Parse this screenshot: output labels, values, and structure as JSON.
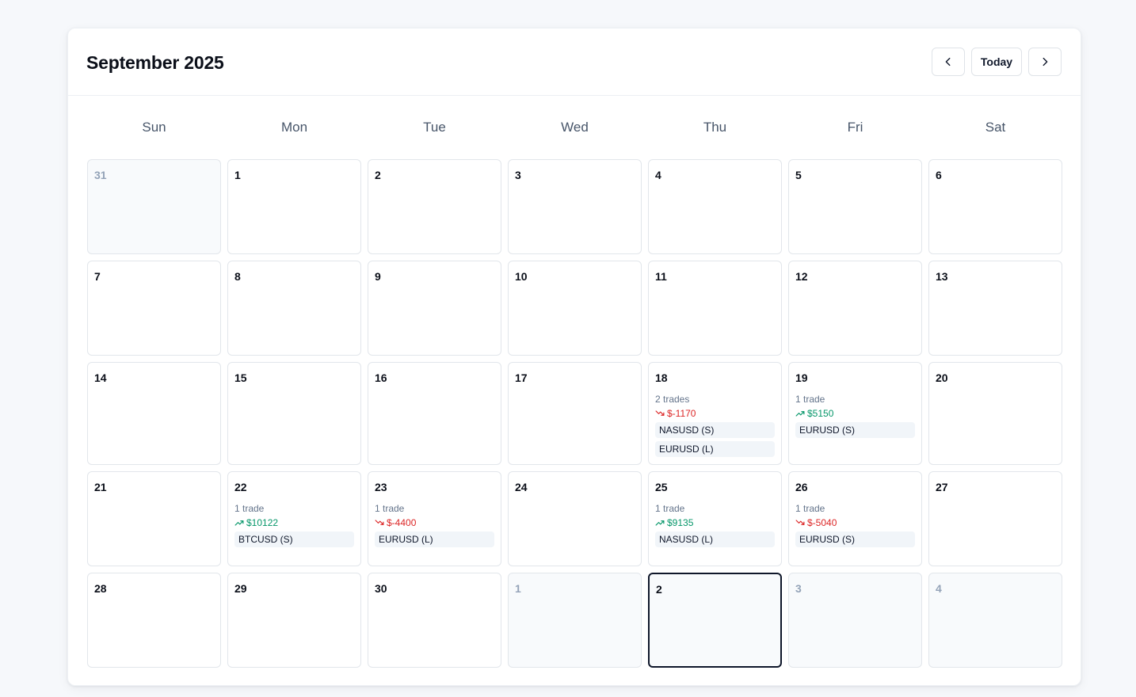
{
  "calendar": {
    "month_title": "September 2025",
    "nav": {
      "prev_icon": "chevron-left-icon",
      "today_label": "Today",
      "next_icon": "chevron-right-icon"
    },
    "weekdays": [
      "Sun",
      "Mon",
      "Tue",
      "Wed",
      "Thu",
      "Fri",
      "Sat"
    ],
    "colors": {
      "positive": "#059669",
      "negative": "#dc2626",
      "today_border": "#0f172a"
    },
    "weeks": [
      [
        {
          "day": "31",
          "outside": true
        },
        {
          "day": "1"
        },
        {
          "day": "2"
        },
        {
          "day": "3"
        },
        {
          "day": "4"
        },
        {
          "day": "5"
        },
        {
          "day": "6"
        }
      ],
      [
        {
          "day": "7"
        },
        {
          "day": "8"
        },
        {
          "day": "9"
        },
        {
          "day": "10"
        },
        {
          "day": "11"
        },
        {
          "day": "12"
        },
        {
          "day": "13"
        }
      ],
      [
        {
          "day": "14"
        },
        {
          "day": "15"
        },
        {
          "day": "16"
        },
        {
          "day": "17"
        },
        {
          "day": "18",
          "trades": "2 trades",
          "pnl": "$-1170",
          "direction": "down",
          "symbols": [
            "NASUSD (S)",
            "EURUSD (L)"
          ]
        },
        {
          "day": "19",
          "trades": "1 trade",
          "pnl": "$5150",
          "direction": "up",
          "symbols": [
            "EURUSD (S)"
          ]
        },
        {
          "day": "20"
        }
      ],
      [
        {
          "day": "21"
        },
        {
          "day": "22",
          "trades": "1 trade",
          "pnl": "$10122",
          "direction": "up",
          "symbols": [
            "BTCUSD (S)"
          ]
        },
        {
          "day": "23",
          "trades": "1 trade",
          "pnl": "$-4400",
          "direction": "down",
          "symbols": [
            "EURUSD (L)"
          ]
        },
        {
          "day": "24"
        },
        {
          "day": "25",
          "trades": "1 trade",
          "pnl": "$9135",
          "direction": "up",
          "symbols": [
            "NASUSD (L)"
          ]
        },
        {
          "day": "26",
          "trades": "1 trade",
          "pnl": "$-5040",
          "direction": "down",
          "symbols": [
            "EURUSD (S)"
          ]
        },
        {
          "day": "27"
        }
      ],
      [
        {
          "day": "28"
        },
        {
          "day": "29"
        },
        {
          "day": "30"
        },
        {
          "day": "1",
          "outside": true
        },
        {
          "day": "2",
          "today": true
        },
        {
          "day": "3",
          "outside": true
        },
        {
          "day": "4",
          "outside": true
        }
      ]
    ]
  }
}
